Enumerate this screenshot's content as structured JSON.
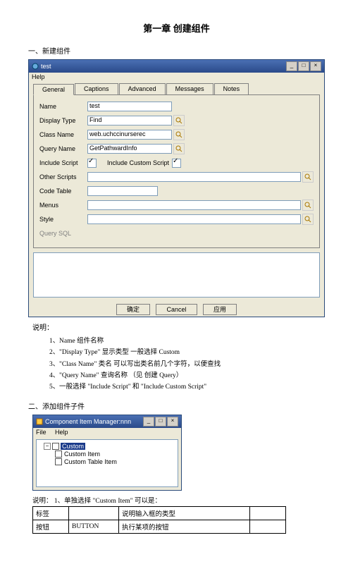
{
  "chapter_title": "第一章 创建组件",
  "section1_title": "一、新建组件",
  "section2_title": "二、添加组件子件",
  "window1": {
    "title": "test",
    "menu_help": "Help",
    "tabs": {
      "general": "General",
      "captions": "Captions",
      "advanced": "Advanced",
      "messages": "Messages",
      "notes": "Notes"
    },
    "rows": {
      "name_label": "Name",
      "name_value": "test",
      "display_type_label": "Display Type",
      "display_type_value": "Find",
      "class_name_label": "Class Name",
      "class_name_value": "web.uchccinurserec",
      "query_name_label": "Query Name",
      "query_name_value": "GetPathwardInfo",
      "include_script_label": "Include Script",
      "include_custom_label": "Include Custom Script",
      "other_scripts_label": "Other Scripts",
      "code_table_label": "Code Table",
      "menus_label": "Menus",
      "style_label": "Style",
      "query_sql_label": "Query SQL"
    },
    "buttons": {
      "ok": "确定",
      "cancel": "Cancel",
      "apply": "应用"
    }
  },
  "explain_label": "说明：",
  "explain1": {
    "i1_k": "1、",
    "i1_h": "Name",
    "i1_t": "  组件名称",
    "i2_k": "2、",
    "i2_h": "\"Display Type\"",
    "i2_t": "   显示类型    一般选择 Custom",
    "i3_k": "3、",
    "i3_h": "\"Class Name\"",
    "i3_t": "   类名    可以写出类名前几个字符，以便查找",
    "i4_k": "4、",
    "i4_h": "\"Query Name\"",
    "i4_t": "   查询名称   （见 创建 Query）",
    "i5_k": "5、",
    "i5_t": "一般选择 \"Include Script\" 和 \"Include Custom Script\""
  },
  "window2": {
    "title": "Component Item Manager:nnn",
    "menu_file": "File",
    "menu_help": "Help",
    "root": "Custom",
    "child1": "Custom Item",
    "child2": "Custom Table Item"
  },
  "explain2_intro": "说明： 1、单独选择 \"Custom Item\" 可以是：",
  "table": {
    "r1c1": "标签",
    "r1c2": "",
    "r1c3": "说明输入框的类型",
    "r2c1": "按钮",
    "r2c2": "BUTTON",
    "r2c3": "执行某项的按钮"
  }
}
